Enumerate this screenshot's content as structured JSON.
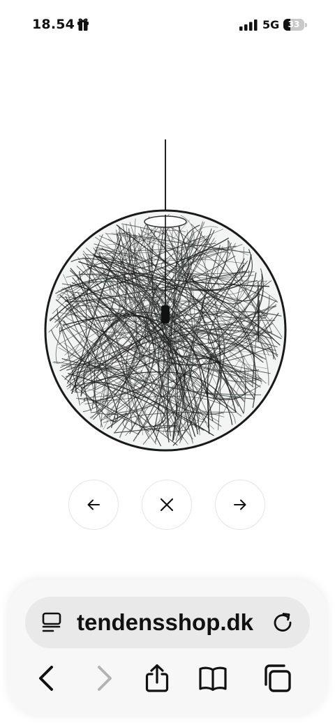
{
  "status_bar": {
    "time": "18.54",
    "network": "5G",
    "battery_level": "33",
    "icons": [
      "gift-icon",
      "cellular-signal-icon",
      "battery-icon"
    ]
  },
  "product": {
    "image": "pendant-lamp-black-wire-ball",
    "image_background": "#ffffff"
  },
  "gallery_controls": {
    "icons": [
      "arrow-left-icon",
      "close-icon",
      "arrow-right-icon"
    ]
  },
  "browser": {
    "url": "tendensshop.dk",
    "address_icons": [
      "reader-mode-icon",
      "reload-icon"
    ],
    "toolbar_icons": [
      "back-chevron-icon",
      "forward-chevron-icon",
      "share-icon",
      "bookmarks-icon",
      "tabs-icon"
    ],
    "forward_enabled": false
  },
  "colors": {
    "text": "#111111",
    "disabled": "#b3b3b3",
    "address_bar": "#e9e9e9",
    "panel": "#f7f7f7"
  }
}
